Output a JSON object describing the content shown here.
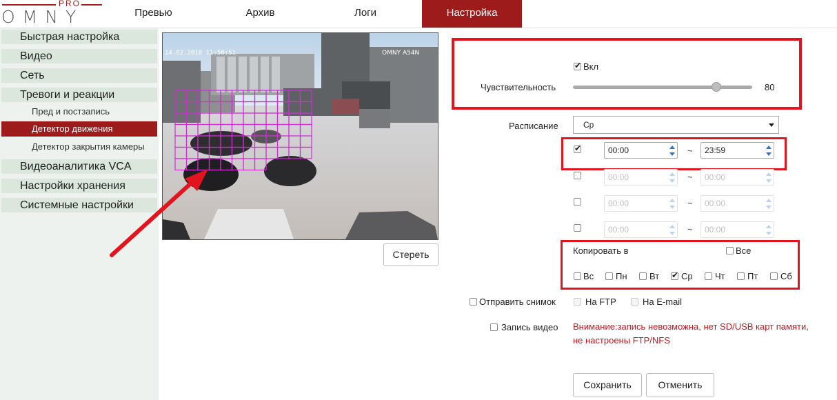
{
  "header": {
    "logo_pro": "PRO",
    "logo_omny": "OMNY",
    "nav": [
      "Превью",
      "Архив",
      "Логи",
      "Настройка"
    ],
    "active_nav": "Настройка",
    "accent": "#9e1b1b"
  },
  "sidebar": {
    "items": [
      "Быстрая настройка",
      "Видео",
      "Сеть",
      "Тревоги и реакции",
      "Пред и постзапись",
      "Детектор движения",
      "Детектор закрытия камеры",
      "Видеоаналитика VCA",
      "Настройки хранения",
      "Системные настройки"
    ],
    "active": "Детектор движения"
  },
  "camera": {
    "timestamp": "14.02.2018 11:58:51",
    "camera_name": "OMNY A54N",
    "clear_button": "Стереть"
  },
  "motion": {
    "enable_label": "Вкл",
    "enabled": true,
    "sensitivity_label": "Чувствительность",
    "sensitivity": 80,
    "sensitivity_max": 100
  },
  "schedule": {
    "label": "Расписание",
    "selected_day": "Ср",
    "rows": [
      {
        "checked": true,
        "from": "00:00",
        "to": "23:59"
      },
      {
        "checked": false,
        "from": "00:00",
        "to": "00:00"
      },
      {
        "checked": false,
        "from": "00:00",
        "to": "00:00"
      },
      {
        "checked": false,
        "from": "00:00",
        "to": "00:00"
      }
    ],
    "separator": "~"
  },
  "copy": {
    "label": "Копировать в",
    "all_label": "Все",
    "days": [
      {
        "label": "Вс",
        "checked": false
      },
      {
        "label": "Пн",
        "checked": false
      },
      {
        "label": "Вт",
        "checked": false
      },
      {
        "label": "Ср",
        "checked": true
      },
      {
        "label": "Чт",
        "checked": false
      },
      {
        "label": "Пт",
        "checked": false
      },
      {
        "label": "Сб",
        "checked": false
      }
    ]
  },
  "actions": {
    "snapshot_label": "Отправить снимок",
    "ftp_label": "На FTP",
    "email_label": "На E-mail",
    "record_label": "Запись видео",
    "warning_line1": "Внимание:запись невозможна, нет SD/USB карт памяти,",
    "warning_line2": "не настроены FTP/NFS",
    "save": "Сохранить",
    "cancel": "Отменить"
  },
  "colors": {
    "accent": "#9e1b1b",
    "annotation_red": "#e3141d",
    "warning": "#d0121b",
    "grid": "#d42cd6"
  }
}
